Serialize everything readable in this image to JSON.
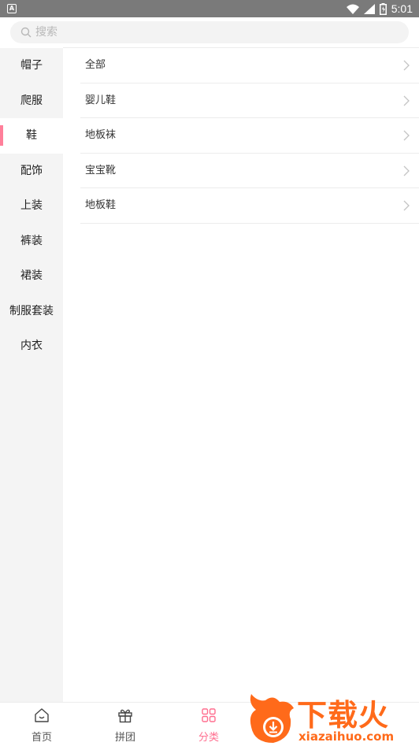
{
  "statusbar": {
    "time": "5:01",
    "app_badge": "A"
  },
  "search": {
    "placeholder": "搜索",
    "value": ""
  },
  "sidebar": {
    "items": [
      {
        "label": "帽子",
        "active": false
      },
      {
        "label": "爬服",
        "active": false
      },
      {
        "label": "鞋",
        "active": true
      },
      {
        "label": "配饰",
        "active": false
      },
      {
        "label": "上装",
        "active": false
      },
      {
        "label": "裤装",
        "active": false
      },
      {
        "label": "裙装",
        "active": false
      },
      {
        "label": "制服套装",
        "active": false
      },
      {
        "label": "内衣",
        "active": false
      }
    ]
  },
  "subcategories": [
    {
      "label": "全部"
    },
    {
      "label": "婴儿鞋"
    },
    {
      "label": "地板袜"
    },
    {
      "label": "宝宝靴"
    },
    {
      "label": "地板鞋"
    }
  ],
  "tabbar": {
    "tabs": [
      {
        "label": "首页",
        "icon": "home-icon",
        "active": false
      },
      {
        "label": "拼团",
        "icon": "gift-icon",
        "active": false
      },
      {
        "label": "分类",
        "icon": "category-grid-icon",
        "active": true
      }
    ]
  },
  "watermark": {
    "logo_text": "下载火",
    "url_text": "xiazaihuo.com"
  },
  "colors": {
    "accent": "#ff6e8f",
    "sidebar_bg": "#f4f4f4",
    "watermark": "#ff6a1a"
  }
}
